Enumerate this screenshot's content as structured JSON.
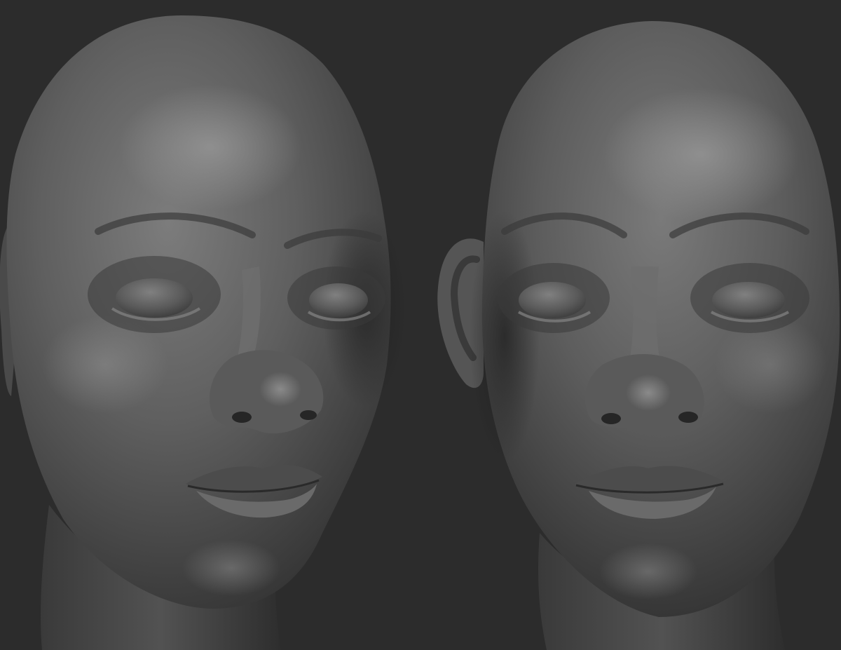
{
  "scene": {
    "background_color": "#2c2c2c",
    "material_color": "#5e5e5e",
    "highlight_color": "#8a8a8a",
    "shadow_color": "#262626",
    "objects": [
      {
        "kind": "sculpted-head",
        "view": "three-quarter-left"
      },
      {
        "kind": "sculpted-head",
        "view": "front"
      }
    ]
  }
}
